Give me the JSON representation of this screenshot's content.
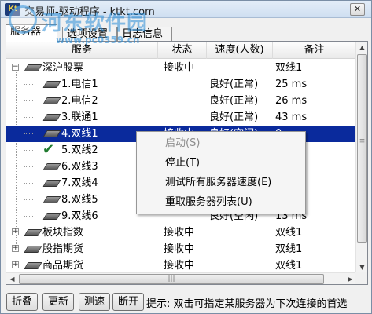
{
  "window": {
    "title": "交易师-驱动程序 - ktkt.com",
    "app_icon_text": "Kt",
    "close_symbol": "✕"
  },
  "watermark": {
    "text": "河东软件园",
    "url": "www.pc0359.cn"
  },
  "tabs": [
    {
      "label": "服务器"
    },
    {
      "label": "选项设置"
    },
    {
      "label": "日志信息"
    }
  ],
  "columns": [
    "服务",
    "状态",
    "速度(人数)",
    "备注"
  ],
  "rows": [
    {
      "name": "深沪股票",
      "status": "接收中",
      "speed": "",
      "note": "双线1",
      "level": 0,
      "expander": "−",
      "icon": "disk-icon"
    },
    {
      "name": "1.电信1",
      "status": "",
      "speed": "良好(正常)",
      "note": "25 ms",
      "level": 1,
      "icon": "disk-icon"
    },
    {
      "name": "2.电信2",
      "status": "",
      "speed": "良好(正常)",
      "note": "26 ms",
      "level": 1,
      "icon": "disk-icon"
    },
    {
      "name": "3.联通1",
      "status": "",
      "speed": "良好(正常)",
      "note": "43 ms",
      "level": 1,
      "icon": "disk-icon"
    },
    {
      "name": "4.双线1",
      "status": "接收中",
      "speed": "良好(空闲)",
      "note": "0",
      "level": 1,
      "icon": "disk-icon",
      "selected": true
    },
    {
      "name": "5.双线2",
      "status": "",
      "speed": "",
      "note": "",
      "level": 1,
      "icon": "check-icon"
    },
    {
      "name": "6.双线3",
      "status": "",
      "speed": "",
      "note": "",
      "level": 1,
      "icon": "disk-icon"
    },
    {
      "name": "7.双线4",
      "status": "",
      "speed": "",
      "note": "",
      "level": 1,
      "icon": "disk-icon"
    },
    {
      "name": "8.双线5",
      "status": "",
      "speed": "",
      "note": "",
      "level": 1,
      "icon": "disk-icon"
    },
    {
      "name": "9.双线6",
      "status": "",
      "speed": "良好(空闲)",
      "note": "13 ms",
      "level": 1,
      "icon": "disk-icon"
    },
    {
      "name": "板块指数",
      "status": "接收中",
      "speed": "",
      "note": "双线1",
      "level": 0,
      "expander": "+",
      "icon": "disk-icon"
    },
    {
      "name": "股指期货",
      "status": "接收中",
      "speed": "",
      "note": "双线1",
      "level": 0,
      "expander": "+",
      "icon": "disk-icon"
    },
    {
      "name": "商品期货",
      "status": "接收中",
      "speed": "",
      "note": "双线1",
      "level": 0,
      "expander": "+",
      "icon": "disk-icon"
    }
  ],
  "context_menu": [
    {
      "label": "启动(S)",
      "disabled": true
    },
    {
      "label": "停止(T)",
      "disabled": false
    },
    {
      "label": "测试所有服务器速度(E)",
      "disabled": false
    },
    {
      "label": "重取服务器列表(U)",
      "disabled": false
    }
  ],
  "toolbar": {
    "collapse_label": "折叠",
    "refresh_label": "更新",
    "speedtest_label": "测速",
    "disconnect_label": "断开",
    "hint": "提示: 双击可指定某服务器为下次连接的首选"
  },
  "scrollbar": {
    "grip": "≡",
    "hgrip": "|||"
  },
  "colors": {
    "selection": "#0a2a9c",
    "check": "#1f7a2e",
    "watermark": "#288cd7"
  }
}
